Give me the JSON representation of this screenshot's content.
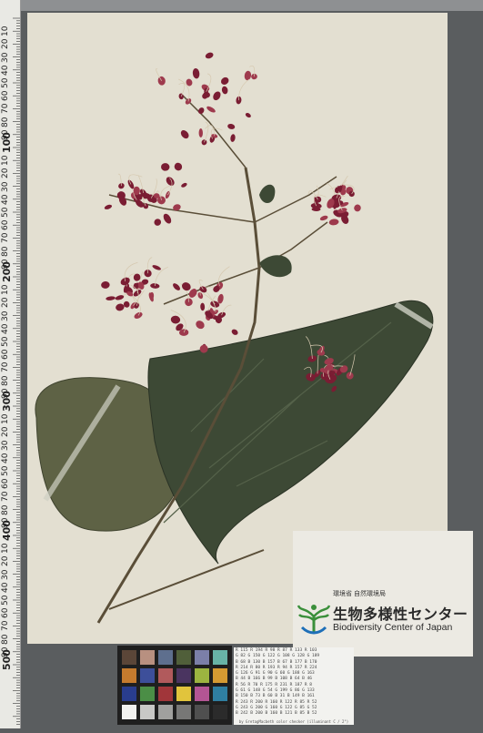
{
  "ruler": {
    "labels": [
      "10",
      "20",
      "30",
      "40",
      "50",
      "60",
      "70",
      "80",
      "90",
      "100",
      "10",
      "20",
      "30",
      "40",
      "50",
      "60",
      "70",
      "80",
      "90",
      "200",
      "10",
      "20",
      "30",
      "40",
      "50",
      "60",
      "70",
      "80",
      "90",
      "300",
      "10",
      "20",
      "30",
      "40",
      "50",
      "60",
      "70",
      "80",
      "90",
      "400",
      "10",
      "20",
      "30",
      "40",
      "50",
      "60",
      "70",
      "80",
      "90",
      "500"
    ]
  },
  "label": {
    "ministry": "環境省 自然環境局",
    "org_name_ja": "生物多様性センター",
    "org_name_en": "Biodiversity Center of Japan"
  },
  "checker": {
    "caption": "by GretagMacbeth color checker (illuminant C / 2°)",
    "patch_colors": [
      "#5b4638",
      "#b89080",
      "#5e6f8e",
      "#505f3a",
      "#7b7fa8",
      "#68b3a6",
      "#c57b2e",
      "#3d4f9a",
      "#b15a5c",
      "#4a3460",
      "#9cb440",
      "#d59a32",
      "#293d8e",
      "#4b8e46",
      "#a1363a",
      "#e1c43c",
      "#b35594",
      "#2f7fa1",
      "#f2f2f0",
      "#c8c8c6",
      "#a0a09e",
      "#777776",
      "#4f4f4f",
      "#2b2b2b"
    ],
    "values": [
      "R 115  R 194  R  98  R  87  R 133  R 103",
      "G  82  G 150  G 122  G 108  G 128  G 189",
      "B  68  B 130  B 157  B  67  B 177  B 170",
      "R 214  R  80  R 193  R  94  R 157  R 224",
      "G 126  G  91  G  90  G  60  G 188  G 163",
      "B  44  B 166  B  99  B 108  B  64  B  46",
      "R  56  R  70  R 175  R 231  R 187  R   8",
      "G  61  G 148  G  54  G 199  G  86  G 133",
      "B 150  B  73  B  60  B  31  B 149  B 161",
      "R 243  R 200  R 160  R 122  R  85  R  52",
      "G 243  G 200  G 160  G 122  G  85  G  52",
      "B 242  B 200  B 160  B 121  B  85  B  52"
    ]
  }
}
